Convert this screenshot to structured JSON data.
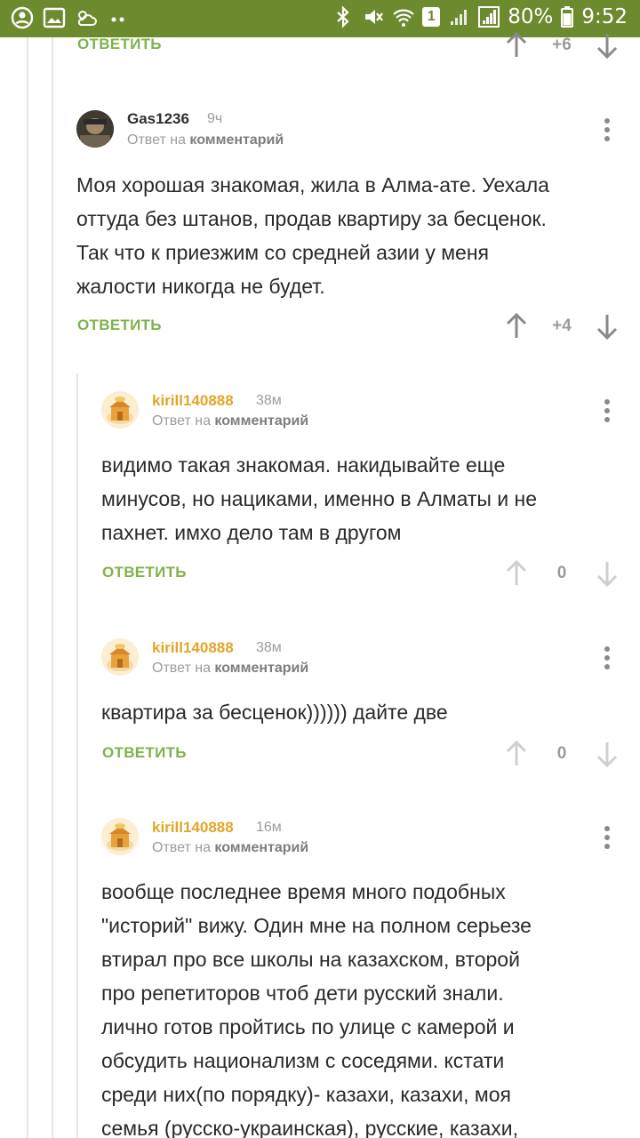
{
  "status_bar": {
    "battery": "80%",
    "time": "9:52",
    "sim": "1"
  },
  "top_partial": {
    "reply_label": "ОТВЕТИТЬ",
    "score": "+6"
  },
  "comments": [
    {
      "author": "Gas1236",
      "time": "9ч",
      "reply_prefix": "Ответ на",
      "reply_target": "комментарий",
      "body": [
        "Моя хорошая знакомая, жила в Алма-ате. Уехала",
        "оттуда без штанов, продав квартиру за бесценок.",
        "Так что к приезжим со средней азии у меня",
        "жалости никогда не будет."
      ],
      "reply_label": "ОТВЕТИТЬ",
      "score": "+4"
    },
    {
      "author": "kirill140888",
      "time": "38м",
      "reply_prefix": "Ответ на",
      "reply_target": "комментарий",
      "body": [
        "видимо такая знакомая. накидывайте еще",
        "минусов, но нациками, именно в Алматы и не",
        "пахнет. имхо дело там в другом"
      ],
      "reply_label": "ОТВЕТИТЬ",
      "score": "0"
    },
    {
      "author": "kirill140888",
      "time": "38м",
      "reply_prefix": "Ответ на",
      "reply_target": "комментарий",
      "body": [
        "квартира за бесценок)))))) дайте две"
      ],
      "reply_label": "ОТВЕТИТЬ",
      "score": "0"
    },
    {
      "author": "kirill140888",
      "time": "16м",
      "reply_prefix": "Ответ на",
      "reply_target": "комментарий",
      "body": [
        "вообще последнее время много подобных",
        "\"историй\" вижу. Один мне на полном серьезе",
        "втирал про все школы на казахском, второй",
        "про репетиторов чтоб дети русский знали.",
        "лично готов пройтись по улице с камерой и",
        "обсудить национализм с соседями. кстати",
        "среди них(по порядку)- казахи, казахи, моя",
        "семья (русско-украинская), русские, казахи,"
      ]
    }
  ],
  "colors": {
    "status_bar": "#6c8a2e",
    "reply_button": "#7fb34a",
    "author_orange": "#e3a527",
    "muted": "#9c9c9c"
  }
}
